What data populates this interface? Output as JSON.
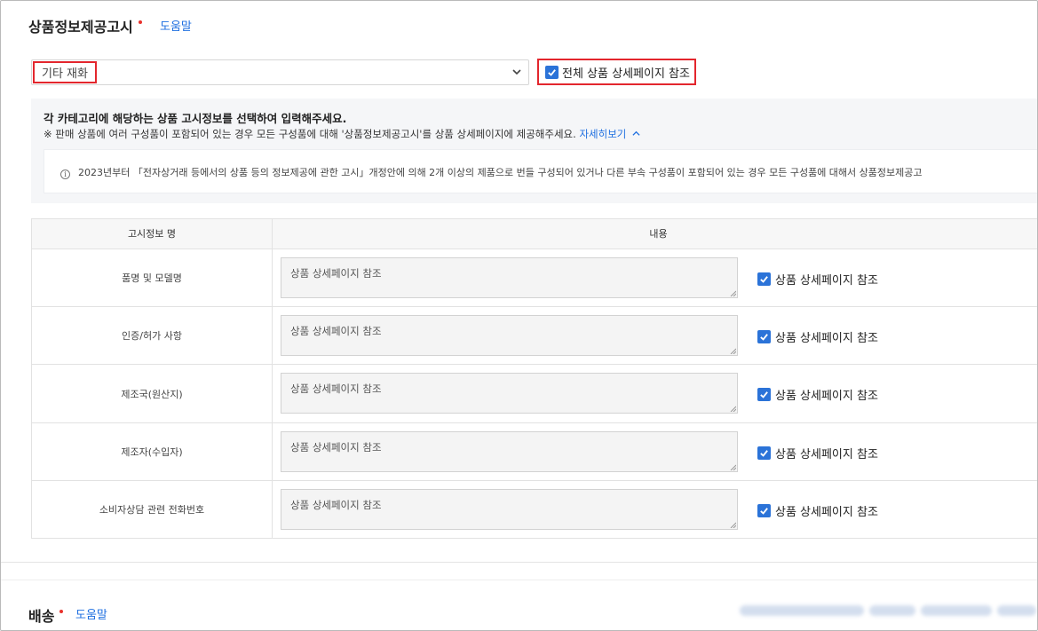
{
  "product_notice": {
    "title": "상품정보제공고시",
    "help_label": "도움말",
    "category_select": {
      "value": "기타 재화"
    },
    "all_reference": {
      "label": "전체 상품 상세페이지 참조",
      "checked": true
    },
    "guide": {
      "title": "각 카테고리에 해당하는 상품 고시정보를 선택하여 입력해주세요.",
      "note": "※ 판매 상품에 여러 구성품이 포함되어 있는 경우 모든 구성품에 대해 '상품정보제공고시'를 상품 상세페이지에 제공해주세요.",
      "more_link": "자세히보기",
      "info_text": "2023년부터 「전자상거래 등에서의 상품 등의 정보제공에 관한 고시」개정안에 의해 2개 이상의 제품으로 번들 구성되어 있거나 다른 부속 구성품이 포함되어 있는 경우 모든 구성품에 대해서 상품정보제공고"
    },
    "table": {
      "headers": {
        "name": "고시정보 명",
        "content": "내용"
      },
      "rows": [
        {
          "name": "품명 및 모델명",
          "value": "상품 상세페이지 참조",
          "check_label": "상품 상세페이지 참조",
          "checked": true
        },
        {
          "name": "인증/허가 사항",
          "value": "상품 상세페이지 참조",
          "check_label": "상품 상세페이지 참조",
          "checked": true
        },
        {
          "name": "제조국(원산지)",
          "value": "상품 상세페이지 참조",
          "check_label": "상품 상세페이지 참조",
          "checked": true
        },
        {
          "name": "제조자(수입자)",
          "value": "상품 상세페이지 참조",
          "check_label": "상품 상세페이지 참조",
          "checked": true
        },
        {
          "name": "소비자상담 관련 전화번호",
          "value": "상품 상세페이지 참조",
          "check_label": "상품 상세페이지 참조",
          "checked": true
        }
      ]
    }
  },
  "shipping": {
    "title": "배송",
    "help_label": "도움말"
  },
  "colors": {
    "accent_blue": "#1f6fe0",
    "checkbox_blue": "#2b73d8",
    "required_red": "#e8322c",
    "highlight_red": "#e3262d"
  }
}
